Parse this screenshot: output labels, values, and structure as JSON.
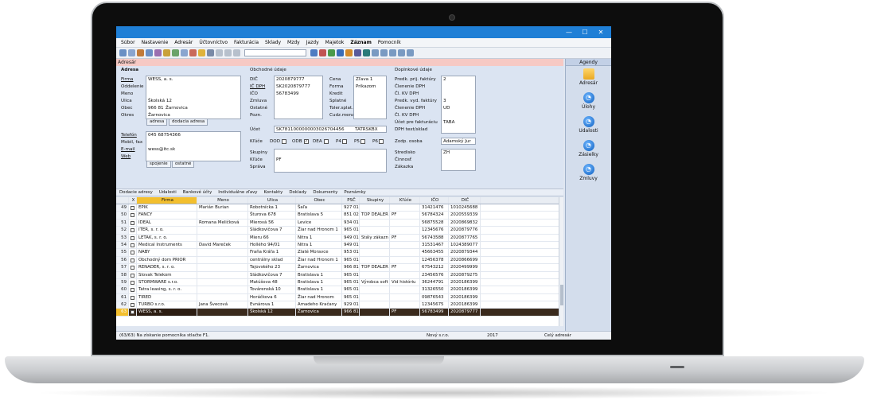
{
  "window": {
    "minimize": "—",
    "maximize": "☐",
    "close": "✕"
  },
  "menu": [
    "Súbor",
    "Nastavenie",
    "Adresár",
    "Účtovníctvo",
    "Fakturácia",
    "Sklady",
    "Mzdy",
    "Jazdy",
    "Majetok",
    "Záznam",
    "Pomocník"
  ],
  "section_title": "Adresár",
  "adresa": {
    "header": "Adresa",
    "labels": {
      "firma": "Firma",
      "oddelenie": "Oddelenie",
      "meno": "Meno",
      "ulica": "Ulica",
      "obec": "Obec",
      "okres": "Okres"
    },
    "firma": "WESS, a. s.",
    "ulica": "Školská 12",
    "psc": "966 81",
    "obec": "Žarnovica",
    "okres": "Žarnovica",
    "tabs": [
      "adresa",
      "dodacia adresa"
    ]
  },
  "kontakt": {
    "labels": {
      "telefon": "Telefón",
      "mobil": "Mobil, fax",
      "email": "E-mail",
      "web": "Web"
    },
    "telefon": "045 68754366",
    "email": "wess@itc.sk",
    "tabs": [
      "spojenie",
      "ostatné"
    ]
  },
  "obchodne": {
    "header": "Obchodné údaje",
    "labels": {
      "dic": "DIČ",
      "icdph": "IČ DPH",
      "ico": "IČO",
      "zmluva": "Zmluva",
      "ostatne": "Ostatné",
      "pozn": "Pozn.",
      "ucet": "Účet",
      "kluce": "Kľúče",
      "skupiny": "Skupiny",
      "kluce2": "Kľúče",
      "sprava": "Správa"
    },
    "dic": "2020879777",
    "icdph": "SK2020879777",
    "ico": "56783499",
    "ucet": "SK7811000000003026704456",
    "banka": "TATRSKBX",
    "checks": [
      "DOD",
      "ODB",
      "DEA",
      "P4",
      "P5",
      "P6"
    ],
    "skupiny": "PF"
  },
  "ceny": {
    "labels": {
      "cena": "Cena",
      "forma": "Forma",
      "kredit": "Kredit",
      "splatne": "Splatné",
      "toler": "Toler.splat.",
      "cudzia": "Cudz.mena"
    },
    "cena": "Zľava 1",
    "forma": "Príkazom"
  },
  "doplnkove": {
    "header": "Doplnkové údaje",
    "labels": {
      "predk_prij": "Predk. prij. faktúry",
      "clenenie1": "Členenie DPH",
      "cl_kv1": "Čl. KV DPH",
      "predk_vyd": "Predk. vyd. faktúry",
      "clenenie2": "Členenie DPH",
      "cl_kv2": "Čl. KV DPH",
      "ucet_fakt": "Účet pre fakturáciu",
      "dph_text": "DPH text/sklad",
      "zodp": "Zodp. osoba",
      "stredisko": "Stredisko",
      "cinnost": "Činnosť",
      "zakazka": "Zákazka"
    },
    "predk_prij": "2",
    "predk_vyd": "3",
    "clenenie2": "UD",
    "ucet_fakt": "TABA",
    "zodp": "Adamský Jur",
    "stredisko": "ZH"
  },
  "bottom_tabs": [
    "Dodacie adresy",
    "Udalosti",
    "Bankové účty",
    "Individuálne zľavy",
    "Kontakty",
    "Doklady",
    "Dokumenty",
    "Poznámky"
  ],
  "grid": {
    "columns": [
      "X",
      "Firma",
      "Meno",
      "Ulica",
      "Obec",
      "PSČ",
      "Skupiny",
      "Kľúče",
      "IČO",
      "DIČ"
    ],
    "rows": [
      [
        "49",
        "EPIK",
        "Marián Burian",
        "Robotnícka 1",
        "Šaľa",
        "927 01",
        "",
        "",
        "31421476",
        "1010245688"
      ],
      [
        "50",
        "FANCY",
        "",
        "Šturova 678",
        "Bratislava 5",
        "851 02",
        "TOP DEALER",
        "PF",
        "56784324",
        "2020559339"
      ],
      [
        "51",
        "IDEAL",
        "Romana Meličková",
        "Mierová 56",
        "Levice",
        "934 01",
        "",
        "",
        "56875528",
        "2020869832"
      ],
      [
        "52",
        "ITER, s. r. o.",
        "",
        "Sládkovičova 7",
        "Žiar nad Hronom 1",
        "965 01",
        "",
        "",
        "12345676",
        "2020879776"
      ],
      [
        "53",
        "LETAK, s. r. o.",
        "",
        "Mieru 66",
        "Nitra 1",
        "949 01",
        "Stály zákazn",
        "PF",
        "56743588",
        "2020877765"
      ],
      [
        "54",
        "Medical Instruments",
        "David Mareček",
        "Hollého 94/01",
        "Nitra 1",
        "949 01",
        "",
        "",
        "31531467",
        "1024389077"
      ],
      [
        "55",
        "NABY",
        "",
        "Fraňa Kráľa 1",
        "Zlaté Moravce",
        "953 01",
        "",
        "",
        "45663455",
        "2020879344"
      ],
      [
        "56",
        "Obchodný dom PRIOR",
        "",
        "centrálny sklad",
        "Žiar nad Hronom 1",
        "965 01",
        "",
        "",
        "12456378",
        "2020866699"
      ],
      [
        "57",
        "RENADER, s. r. o.",
        "",
        "Tajovského 23",
        "Žarnovica",
        "966 81",
        "TOP DEALER",
        "PF",
        "67543212",
        "2020499999"
      ],
      [
        "58",
        "Slovak Telekom",
        "",
        "Sládkovičova 7",
        "Bratislava 1",
        "965 01",
        "",
        "",
        "23456576",
        "2020879275"
      ],
      [
        "59",
        "STORMWARE s.r.o.",
        "",
        "Matúšova 48",
        "Bratislava 1",
        "965 01",
        "Výrobca soft",
        "Vid históriu",
        "36244791",
        "2020186399"
      ],
      [
        "60",
        "Tatra leasing, s. r. o.",
        "",
        "Továrenská 10",
        "Bratislava 1",
        "965 01",
        "",
        "",
        "31326550",
        "2020186399"
      ],
      [
        "61",
        "TIRED",
        "",
        "Horáčkova 6",
        "Žiar nad Hronom",
        "965 01",
        "",
        "",
        "09876543",
        "2020186399"
      ],
      [
        "62",
        "TURBO s.r.o.",
        "Jana Švecová",
        "Evnárova 1",
        "Amadeho Kračany",
        "929 01",
        "",
        "",
        "12345675",
        "2020186399"
      ],
      [
        "63",
        "WESS, a. s.",
        "",
        "Školská 12",
        "Žarnovica",
        "966 81",
        "",
        "PF",
        "56783499",
        "2020879777"
      ]
    ]
  },
  "agendy": {
    "header": "Agendy",
    "items": [
      "Adresár",
      "Úlohy",
      "Udalosti",
      "Zásielky",
      "Zmluvy"
    ]
  },
  "status": {
    "left": "(63/63) Na získanie pomocníka stlačte F1.",
    "company": "Nový s.r.o.",
    "year": "2017",
    "scope": "Celý adresár"
  },
  "colors": {
    "titlebar": "#1f7fd6",
    "section": "#f6c9c4",
    "selected_row": "#3a2a1c",
    "header_accent": "#f3bf2e"
  }
}
